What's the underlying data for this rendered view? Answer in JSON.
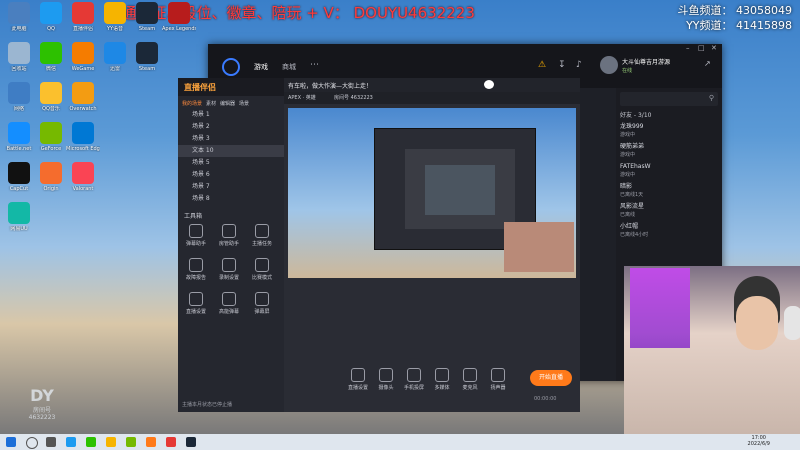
{
  "overlay": {
    "promo_red": "★通行证、段位、徽章、陪玩 + V： DOUYU4632223",
    "channel_1": "斗鱼频道： 43058049",
    "channel_2": "YY频道： 41415898"
  },
  "desktop_icons": [
    {
      "label": "此电脑",
      "color": "#4a7fbf"
    },
    {
      "label": "QQ",
      "color": "#1d9bf0"
    },
    {
      "label": "直播伴侣",
      "color": "#e53935"
    },
    {
      "label": "YY语音",
      "color": "#f6b400"
    },
    {
      "label": "Steam",
      "color": "#1b2838"
    },
    {
      "label": "Apex Legends",
      "color": "#b71c1c"
    },
    {
      "label": "回收站",
      "color": "#9bb6d1"
    },
    {
      "label": "微信",
      "color": "#2dc100"
    },
    {
      "label": "WeGame",
      "color": "#f57c00"
    },
    {
      "label": "迅雷",
      "color": "#1e88e5"
    },
    {
      "label": "Steam",
      "color": "#1b2838"
    },
    {
      "label": "网络",
      "color": "#3f7dc4"
    },
    {
      "label": "QQ音乐",
      "color": "#fbc02d"
    },
    {
      "label": "Overwatch",
      "color": "#f39c12"
    },
    {
      "label": "Battle.net",
      "color": "#148eff"
    },
    {
      "label": "GeForce",
      "color": "#76b900"
    },
    {
      "label": "Microsoft Edge",
      "color": "#0078d4"
    },
    {
      "label": "CapCut",
      "color": "#111111"
    },
    {
      "label": "Origin",
      "color": "#f56c2d"
    },
    {
      "label": "Valorant",
      "color": "#fa4454"
    },
    {
      "label": "网易UU",
      "color": "#13b8a6"
    }
  ],
  "window": {
    "tab_game": "游戏",
    "tab_shop": "商城",
    "user_name": "大斗仙尊吉月游源",
    "status": "在线",
    "friends_count": "好友 - 3/10"
  },
  "streamer_app": {
    "brand": "直播伴侣",
    "menu": [
      "我的场景",
      "素材",
      "编辑器",
      "场景"
    ],
    "scenes": [
      "场景 1",
      "场景 2",
      "场景 3",
      "文本 10",
      "场景 5",
      "场景 6",
      "场景 7",
      "场景 8"
    ],
    "tools_title": "工具箱",
    "tools": [
      "弹幕助手",
      "房管助手",
      "主播任务",
      "故障报告",
      "录制设置",
      "比赛模式",
      "直播设置",
      "高能弹幕",
      "弹幕屏"
    ],
    "notice": "主播本月状态已停止播",
    "title_text": "有车啦，做大作演—大街上走！",
    "category": "APEX · 英雄",
    "room": "房间号 4632223",
    "toolbar": [
      "直播设置",
      "摄像头",
      "手机投屏",
      "多媒体",
      "麦克风",
      "扬声器"
    ],
    "go_live": "开始直播",
    "timer": "00:00:00"
  },
  "friends": [
    {
      "name": "龙珠999",
      "sub": "游戏中"
    },
    {
      "name": "硬筋弟弟",
      "sub": "游戏中"
    },
    {
      "name": "FATEhasW",
      "sub": "游戏中"
    },
    {
      "name": "暗影",
      "sub": "已离线1天"
    },
    {
      "name": "风影流星",
      "sub": "已离线"
    },
    {
      "name": "小红帽",
      "sub": "已离线4小时"
    }
  ],
  "taskbar": {
    "time": "17:00",
    "date": "2022/6/9"
  },
  "watermark": {
    "room_label": "房间号",
    "room_number": "4632223"
  },
  "colors": {
    "accent_orange": "#ff7a1a",
    "overlay_red": "#ff3b3b"
  }
}
